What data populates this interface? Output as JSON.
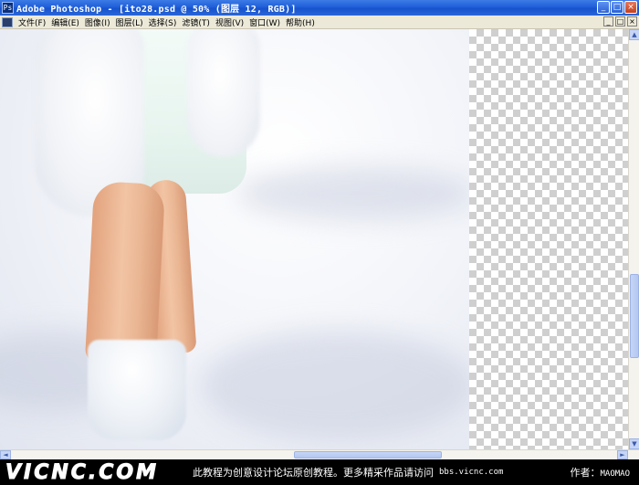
{
  "window": {
    "icon_glyph": "Ps",
    "title": "Adobe Photoshop - [ito28.psd @ 50% (图层 12, RGB)]",
    "buttons": [
      "_",
      "□",
      "×"
    ]
  },
  "menubar": {
    "items": [
      "文件(F)",
      "编辑(E)",
      "图像(I)",
      "图层(L)",
      "选择(S)",
      "滤镜(T)",
      "视图(V)",
      "窗口(W)",
      "帮助(H)"
    ],
    "doc_buttons": [
      "_",
      "□",
      "×"
    ]
  },
  "canvas": {
    "zoom": "50%",
    "layer": "图层 12",
    "mode": "RGB"
  },
  "scrollbars": {
    "up_arrow": "▲",
    "down_arrow": "▼",
    "left_arrow": "◄",
    "right_arrow": "►"
  },
  "watermark": {
    "logo": "VICNC.COM",
    "text": "此教程为创意设计论坛原创教程。更多精采作品请访问",
    "url": "bbs.vicnc.com",
    "author_label": "作者：",
    "author": "MAOMAO"
  }
}
